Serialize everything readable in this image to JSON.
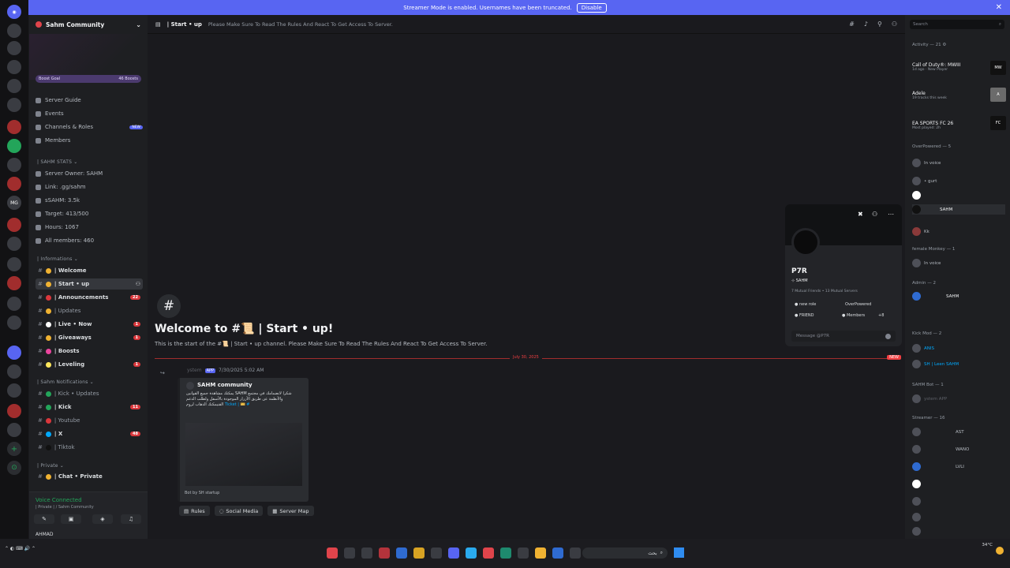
{
  "banner": {
    "text": "Streamer Mode is enabled. Usernames have been truncated.",
    "disable": "Disable"
  },
  "server": {
    "name": "Sahm Community",
    "boost_goal": "Boost Goal",
    "boost_count": "46 Boosts",
    "menu": [
      "Server Guide",
      "Events",
      "Channels & Roles",
      "Members"
    ],
    "new_badge": "NEW",
    "stats_category": "SAHM STATS",
    "stats": [
      "Server Owner: SAHM",
      "Link: .gg/sahm",
      "sSAHM: 3.5k",
      "Target: 413/500",
      "Hours: 1067",
      "All members: 460"
    ],
    "cat_informations": "Informations",
    "informations": [
      {
        "label": "| Welcome",
        "count": ""
      },
      {
        "label": "| Start • up",
        "count": ""
      },
      {
        "label": "| Announcements",
        "count": "22"
      },
      {
        "label": "| Updates",
        "count": ""
      },
      {
        "label": "| Live • Now",
        "count": "1"
      },
      {
        "label": "| Giveaways",
        "count": "1"
      },
      {
        "label": "| Boosts",
        "count": ""
      },
      {
        "label": "| Leveling",
        "count": "1"
      }
    ],
    "cat_notifications": "Sahm Notifications",
    "notifications": [
      {
        "label": "| Kick • Updates",
        "count": ""
      },
      {
        "label": "| Kick",
        "count": "11"
      },
      {
        "label": "| Youtube",
        "count": ""
      },
      {
        "label": "| X",
        "count": "48"
      },
      {
        "label": "| Tiktok",
        "count": ""
      }
    ],
    "cat_private": "Private",
    "private": [
      {
        "label": "| Chat • Private"
      }
    ],
    "voice_connected": "Voice Connected",
    "voice_sub": "| Private | / Sahm Community",
    "user": "AHMAD"
  },
  "channel": {
    "title": "| Start • up",
    "description": "Please Make Sure To Read The Rules And React To Get Access To Server.",
    "welcome_title": "Welcome to #📜 | Start • up!",
    "welcome_sub": "This is the start of the #📜 | Start • up channel. Please Make Sure To Read The Rules And React To Get Access To Server.",
    "date_divider": "July 30, 2025",
    "new_badge": "NEW",
    "msg_app": "APP",
    "msg_time": "7/30/2025 5:02 AM",
    "embed_title": "SAHM community",
    "embed_body": "شكرا لانضمامك في مجتمع SAHM يمكنك مشاهدة جميع القوانين والأنظمة عن طريق الأزرار الموجودة بالأسفل ولطلب الدعم",
    "embed_ticket": "# 🎫 | Ticket",
    "embed_body2": "القنيمكنك الذهاب لروم",
    "embed_footer": "Bot by SH startup",
    "buttons": [
      "Rules",
      "Social Media",
      "Server Map"
    ]
  },
  "popout": {
    "name": "P7R",
    "server_tag": "SAHM",
    "mutual": "7 Mutual Friends • 13 Mutual Servers",
    "roles": [
      "new role",
      "OverPowered",
      "FRIEND",
      "Members",
      "+8"
    ],
    "message_placeholder": "Message @P7R"
  },
  "members": {
    "search": "Search",
    "activity": "Activity — 21",
    "activities": [
      {
        "title": "Call of Duty®: MWIII",
        "sub": "1d ago",
        "badge": "New Player",
        "img": "MW"
      },
      {
        "title": "Adele",
        "sub": "19 tracks this week",
        "img": "A"
      },
      {
        "title": "EA SPORTS FC 26",
        "sub": "Most played: 2h",
        "img": "FC"
      }
    ],
    "groups": [
      {
        "name": "OverPowered — 5",
        "items": [
          "In voice",
          "• gurt",
          "",
          "SAHM",
          "Kk"
        ]
      },
      {
        "name": "female Monkey — 1",
        "items": [
          "In voice"
        ]
      },
      {
        "name": "Admin — 2",
        "items": [
          "SAHM",
          ""
        ]
      },
      {
        "name": "Kick Mod — 2",
        "items": [
          "ANIS",
          "SH | Leen  SAHM"
        ]
      },
      {
        "name": "SAHM Bot — 1",
        "items": [
          "ystem APP"
        ]
      },
      {
        "name": "Streamer — 16",
        "items": [
          "AST",
          "WANO",
          "LVLI",
          "",
          "",
          "",
          ""
        ]
      }
    ]
  },
  "taskbar": {
    "weather": "34°C",
    "search": "بحث"
  }
}
